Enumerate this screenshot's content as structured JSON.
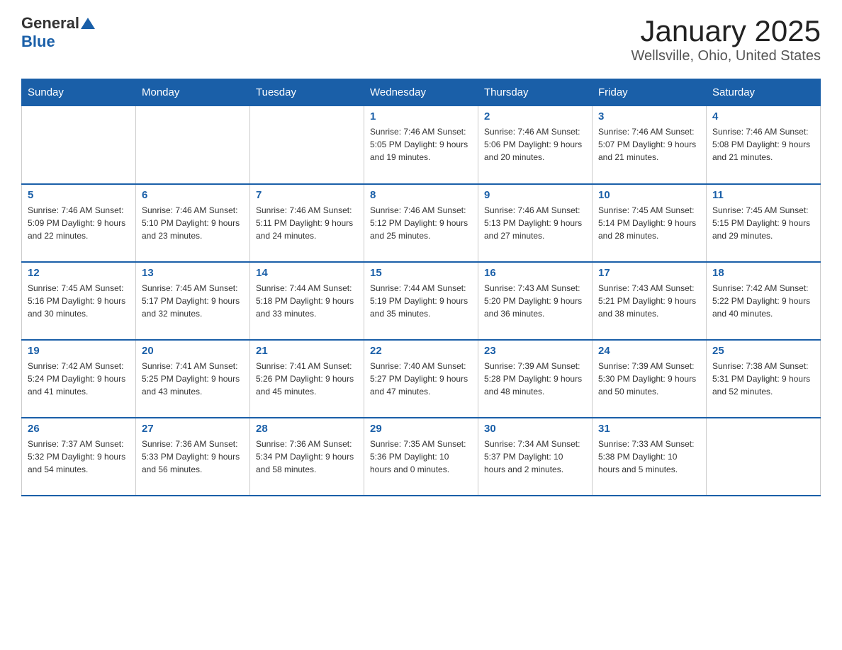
{
  "header": {
    "logo_general": "General",
    "logo_blue": "Blue",
    "title": "January 2025",
    "location": "Wellsville, Ohio, United States"
  },
  "days_of_week": [
    "Sunday",
    "Monday",
    "Tuesday",
    "Wednesday",
    "Thursday",
    "Friday",
    "Saturday"
  ],
  "weeks": [
    [
      {
        "day": "",
        "info": ""
      },
      {
        "day": "",
        "info": ""
      },
      {
        "day": "",
        "info": ""
      },
      {
        "day": "1",
        "info": "Sunrise: 7:46 AM\nSunset: 5:05 PM\nDaylight: 9 hours\nand 19 minutes."
      },
      {
        "day": "2",
        "info": "Sunrise: 7:46 AM\nSunset: 5:06 PM\nDaylight: 9 hours\nand 20 minutes."
      },
      {
        "day": "3",
        "info": "Sunrise: 7:46 AM\nSunset: 5:07 PM\nDaylight: 9 hours\nand 21 minutes."
      },
      {
        "day": "4",
        "info": "Sunrise: 7:46 AM\nSunset: 5:08 PM\nDaylight: 9 hours\nand 21 minutes."
      }
    ],
    [
      {
        "day": "5",
        "info": "Sunrise: 7:46 AM\nSunset: 5:09 PM\nDaylight: 9 hours\nand 22 minutes."
      },
      {
        "day": "6",
        "info": "Sunrise: 7:46 AM\nSunset: 5:10 PM\nDaylight: 9 hours\nand 23 minutes."
      },
      {
        "day": "7",
        "info": "Sunrise: 7:46 AM\nSunset: 5:11 PM\nDaylight: 9 hours\nand 24 minutes."
      },
      {
        "day": "8",
        "info": "Sunrise: 7:46 AM\nSunset: 5:12 PM\nDaylight: 9 hours\nand 25 minutes."
      },
      {
        "day": "9",
        "info": "Sunrise: 7:46 AM\nSunset: 5:13 PM\nDaylight: 9 hours\nand 27 minutes."
      },
      {
        "day": "10",
        "info": "Sunrise: 7:45 AM\nSunset: 5:14 PM\nDaylight: 9 hours\nand 28 minutes."
      },
      {
        "day": "11",
        "info": "Sunrise: 7:45 AM\nSunset: 5:15 PM\nDaylight: 9 hours\nand 29 minutes."
      }
    ],
    [
      {
        "day": "12",
        "info": "Sunrise: 7:45 AM\nSunset: 5:16 PM\nDaylight: 9 hours\nand 30 minutes."
      },
      {
        "day": "13",
        "info": "Sunrise: 7:45 AM\nSunset: 5:17 PM\nDaylight: 9 hours\nand 32 minutes."
      },
      {
        "day": "14",
        "info": "Sunrise: 7:44 AM\nSunset: 5:18 PM\nDaylight: 9 hours\nand 33 minutes."
      },
      {
        "day": "15",
        "info": "Sunrise: 7:44 AM\nSunset: 5:19 PM\nDaylight: 9 hours\nand 35 minutes."
      },
      {
        "day": "16",
        "info": "Sunrise: 7:43 AM\nSunset: 5:20 PM\nDaylight: 9 hours\nand 36 minutes."
      },
      {
        "day": "17",
        "info": "Sunrise: 7:43 AM\nSunset: 5:21 PM\nDaylight: 9 hours\nand 38 minutes."
      },
      {
        "day": "18",
        "info": "Sunrise: 7:42 AM\nSunset: 5:22 PM\nDaylight: 9 hours\nand 40 minutes."
      }
    ],
    [
      {
        "day": "19",
        "info": "Sunrise: 7:42 AM\nSunset: 5:24 PM\nDaylight: 9 hours\nand 41 minutes."
      },
      {
        "day": "20",
        "info": "Sunrise: 7:41 AM\nSunset: 5:25 PM\nDaylight: 9 hours\nand 43 minutes."
      },
      {
        "day": "21",
        "info": "Sunrise: 7:41 AM\nSunset: 5:26 PM\nDaylight: 9 hours\nand 45 minutes."
      },
      {
        "day": "22",
        "info": "Sunrise: 7:40 AM\nSunset: 5:27 PM\nDaylight: 9 hours\nand 47 minutes."
      },
      {
        "day": "23",
        "info": "Sunrise: 7:39 AM\nSunset: 5:28 PM\nDaylight: 9 hours\nand 48 minutes."
      },
      {
        "day": "24",
        "info": "Sunrise: 7:39 AM\nSunset: 5:30 PM\nDaylight: 9 hours\nand 50 minutes."
      },
      {
        "day": "25",
        "info": "Sunrise: 7:38 AM\nSunset: 5:31 PM\nDaylight: 9 hours\nand 52 minutes."
      }
    ],
    [
      {
        "day": "26",
        "info": "Sunrise: 7:37 AM\nSunset: 5:32 PM\nDaylight: 9 hours\nand 54 minutes."
      },
      {
        "day": "27",
        "info": "Sunrise: 7:36 AM\nSunset: 5:33 PM\nDaylight: 9 hours\nand 56 minutes."
      },
      {
        "day": "28",
        "info": "Sunrise: 7:36 AM\nSunset: 5:34 PM\nDaylight: 9 hours\nand 58 minutes."
      },
      {
        "day": "29",
        "info": "Sunrise: 7:35 AM\nSunset: 5:36 PM\nDaylight: 10 hours\nand 0 minutes."
      },
      {
        "day": "30",
        "info": "Sunrise: 7:34 AM\nSunset: 5:37 PM\nDaylight: 10 hours\nand 2 minutes."
      },
      {
        "day": "31",
        "info": "Sunrise: 7:33 AM\nSunset: 5:38 PM\nDaylight: 10 hours\nand 5 minutes."
      },
      {
        "day": "",
        "info": ""
      }
    ]
  ]
}
